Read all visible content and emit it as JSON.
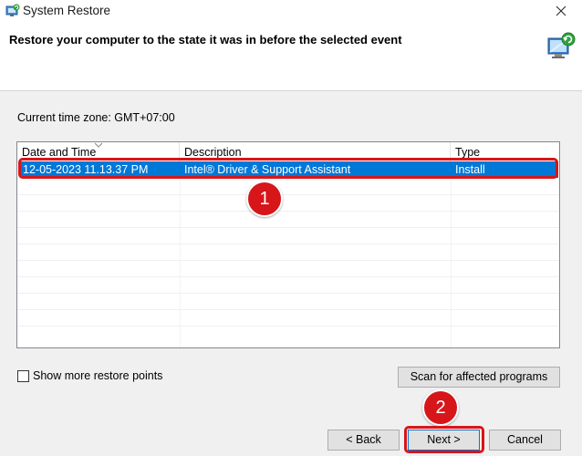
{
  "window": {
    "title": "System Restore",
    "header_text": "Restore your computer to the state it was in before the selected event"
  },
  "timezone": {
    "text": "Current time zone: GMT+07:00"
  },
  "table": {
    "columns": [
      "Date and Time",
      "Description",
      "Type"
    ],
    "rows": [
      {
        "date": "12-05-2023 11.13.37 PM",
        "description": "Intel® Driver & Support Assistant",
        "type": "Install",
        "selected": true
      }
    ]
  },
  "options": {
    "show_more_label": "Show more restore points",
    "show_more_checked": false
  },
  "buttons": {
    "scan": "Scan for affected programs",
    "back": "< Back",
    "next": "Next >",
    "cancel": "Cancel"
  },
  "annotations": {
    "callout_1": "1",
    "callout_2": "2"
  },
  "colors": {
    "selection": "#0078d7",
    "highlight": "#d7161a"
  },
  "icons": {
    "app": "system-restore-icon",
    "header": "system-restore-large-icon",
    "close": "close-icon"
  }
}
